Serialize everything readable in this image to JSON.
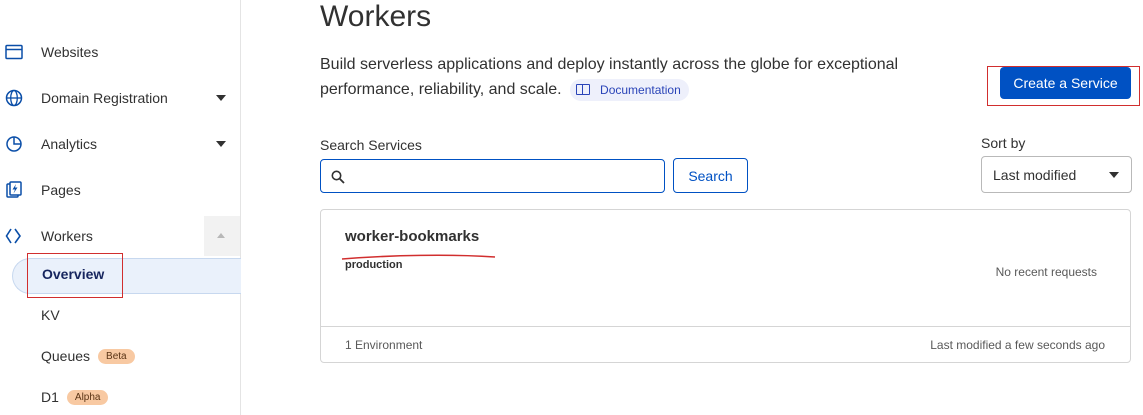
{
  "sidebar": {
    "items": [
      {
        "label": "Websites",
        "icon": "browser-window-icon"
      },
      {
        "label": "Domain Registration",
        "icon": "globe-icon"
      },
      {
        "label": "Analytics",
        "icon": "pie-chart-icon"
      },
      {
        "label": "Pages",
        "icon": "pages-bolt-icon"
      },
      {
        "label": "Workers",
        "icon": "workers-chevrons-icon"
      }
    ],
    "workers_sub": {
      "overview": "Overview",
      "kv": "KV",
      "queues": "Queues",
      "queues_badge": "Beta",
      "d1": "D1",
      "d1_badge": "Alpha"
    }
  },
  "main": {
    "title": "Workers",
    "description": "Build serverless applications and deploy instantly across the globe for exceptional performance, reliability, and scale.",
    "documentation_link": "Documentation",
    "create_button": "Create a Service",
    "search": {
      "label": "Search Services",
      "placeholder": "",
      "value": "",
      "button": "Search"
    },
    "sort": {
      "label": "Sort by",
      "selected": "Last modified"
    },
    "service_card": {
      "name": "worker-bookmarks",
      "environment": "production",
      "requests_status": "No recent requests",
      "environment_count": "1 Environment",
      "last_modified": "Last modified a few seconds ago"
    }
  },
  "colors": {
    "accent": "#0051c3",
    "annotation_red": "#d12e2e",
    "badge_bg": "#f8c9a2"
  }
}
